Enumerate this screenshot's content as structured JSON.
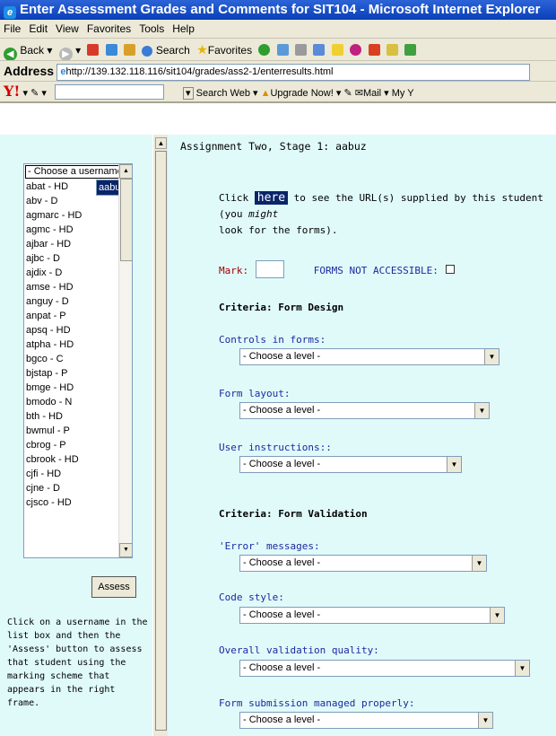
{
  "window": {
    "title": "Enter Assessment Grades and Comments for SIT104 - Microsoft Internet Explorer"
  },
  "menu": [
    "File",
    "Edit",
    "View",
    "Favorites",
    "Tools",
    "Help"
  ],
  "toolbar": {
    "back": "Back",
    "search": "Search",
    "favorites": "Favorites"
  },
  "address": {
    "label": "Address",
    "url": "http://139.132.118.116/sit104/grades/ass2-1/enterresults.html"
  },
  "yahoo": {
    "logo": "Y!",
    "search_web": "Search Web",
    "upgrade": "Upgrade Now!",
    "mail": "Mail",
    "my": "My Y"
  },
  "left": {
    "list_header": "- Choose a username -",
    "users": [
      "aabuz - D",
      "abat - HD",
      "abv - D",
      "agmarc - HD",
      "agmc - HD",
      "ajbar - HD",
      "ajbc - D",
      "ajdix - D",
      "amse - HD",
      "anguy - D",
      "anpat - P",
      "apsq - HD",
      "atpha - HD",
      "bgco - C",
      "bjstap - P",
      "bmge - HD",
      "bmodo - N",
      "bth - HD",
      "bwmul - P",
      "cbrog - P",
      "cbrook - HD",
      "cjfi - HD",
      "cjne - D",
      "cjsco - HD"
    ],
    "selected_index": 0,
    "assess_label": "Assess",
    "help": "Click on a username in the list box and then the 'Assess' button to assess that student using the marking scheme that appears in the right frame."
  },
  "right": {
    "title": "Assignment Two, Stage 1: aabuz",
    "click_pre": "Click ",
    "here": "here",
    "click_post": " to see the URL(s) supplied by this student (you ",
    "might": "might",
    "click_end": "look for the forms).",
    "mark_label": "Mark:",
    "forms_na": "FORMS NOT ACCESSIBLE:",
    "criteria_design": "Criteria: Form Design",
    "criteria_validation": "Criteria: Form Validation",
    "select_placeholder": "- Choose a level -",
    "fields": {
      "controls": "Controls in forms:",
      "layout": "Form layout:",
      "instructions": "User instructions::",
      "errors": "'Error' messages:",
      "codestyle": "Code style:",
      "overall": "Overall validation quality:",
      "submission": "Form submission managed properly:"
    }
  }
}
